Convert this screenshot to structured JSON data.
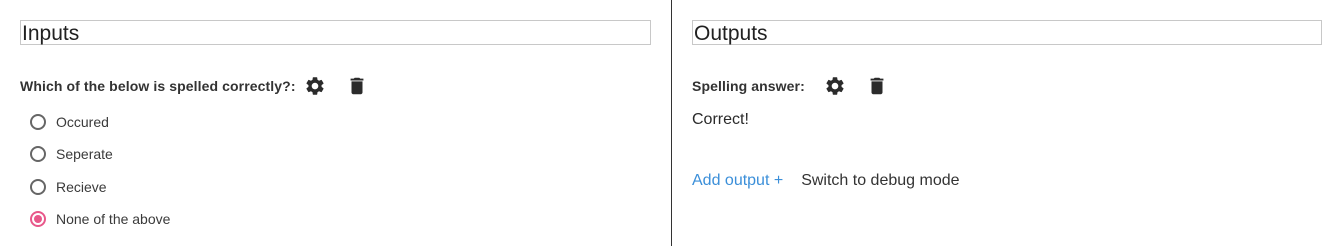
{
  "inputs": {
    "title": "Inputs",
    "question_label": "Which of the below is spelled correctly?:",
    "options": [
      {
        "label": "Occured",
        "selected": false
      },
      {
        "label": "Seperate",
        "selected": false
      },
      {
        "label": "Recieve",
        "selected": false
      },
      {
        "label": "None of the above",
        "selected": true
      }
    ]
  },
  "outputs": {
    "title": "Outputs",
    "answer_label": "Spelling answer:",
    "answer_value": "Correct!",
    "add_output_label": "Add output +",
    "debug_mode_label": "Switch to debug mode"
  },
  "icons": {
    "settings": "gear-icon",
    "delete": "trash-icon"
  },
  "colors": {
    "accent_pink": "#e8588a",
    "link_blue": "#3b8fd9",
    "divider": "#333333"
  }
}
